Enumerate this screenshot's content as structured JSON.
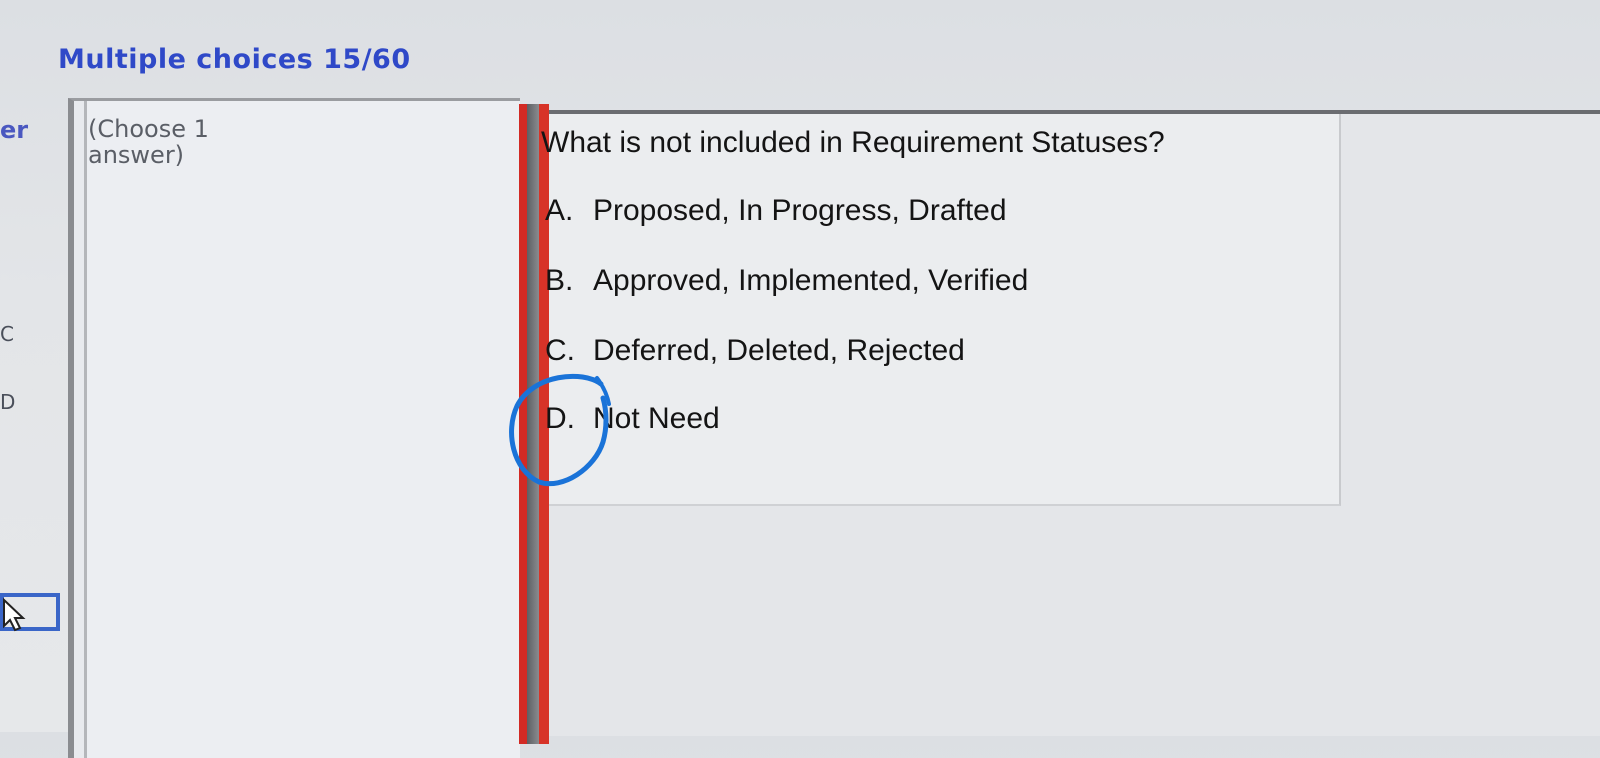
{
  "header": {
    "title": "Multiple choices 15/60"
  },
  "sidebar": {
    "label": "er",
    "letters": [
      "C",
      "D"
    ]
  },
  "left_panel": {
    "hint": "(Choose 1 answer)"
  },
  "question": {
    "text": "What is not included in Requirement Statuses?",
    "options": [
      {
        "letter": "A.",
        "text": "Proposed, In Progress, Drafted"
      },
      {
        "letter": "B.",
        "text": "Approved, Implemented, Verified"
      },
      {
        "letter": "C.",
        "text": "Deferred, Deleted, Rejected"
      },
      {
        "letter": "D.",
        "text": "Not Need"
      }
    ]
  },
  "annotation": {
    "circled_option": "D.",
    "color": "#1a73d8"
  },
  "colors": {
    "title": "#2f49c8",
    "divider": "#d22a24"
  }
}
